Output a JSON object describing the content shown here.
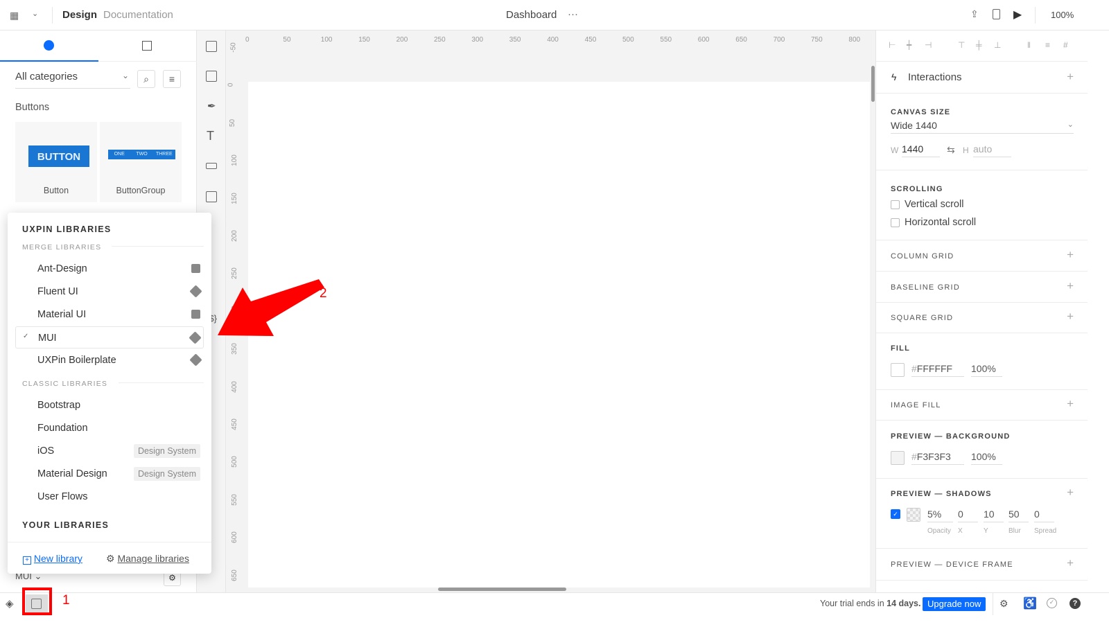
{
  "topbar": {
    "tabs": [
      "Design",
      "Documentation"
    ],
    "title": "Dashboard",
    "more": "···",
    "zoom": "100%"
  },
  "left": {
    "category": "All categories",
    "section": "Buttons",
    "components": [
      {
        "label": "Button",
        "preview": "BUTTON"
      },
      {
        "label": "ButtonGroup",
        "preview": [
          "ONE",
          "TWO",
          "THREE"
        ]
      }
    ],
    "library": "MUI"
  },
  "popup": {
    "title": "UXPIN LIBRARIES",
    "merge_header": "MERGE LIBRARIES",
    "merge": [
      {
        "name": "Ant-Design",
        "icon": "storybook-icon"
      },
      {
        "name": "Fluent UI",
        "icon": "git-icon"
      },
      {
        "name": "Material UI",
        "icon": "storybook-s-icon"
      },
      {
        "name": "MUI",
        "icon": "git-icon",
        "selected": true
      },
      {
        "name": "UXPin Boilerplate",
        "icon": "git-icon"
      }
    ],
    "classic_header": "CLASSIC LIBRARIES",
    "classic": [
      {
        "name": "Bootstrap"
      },
      {
        "name": "Foundation"
      },
      {
        "name": "iOS",
        "badge": "Design System"
      },
      {
        "name": "Material Design",
        "badge": "Design System"
      },
      {
        "name": "User Flows"
      }
    ],
    "your_header": "YOUR LIBRARIES",
    "new_library": "New library",
    "manage_libraries": "Manage libraries"
  },
  "rulers": {
    "h": [
      "0",
      "50",
      "100",
      "150",
      "200",
      "250",
      "300",
      "350",
      "400",
      "450",
      "500",
      "550",
      "600",
      "650",
      "700",
      "750",
      "800"
    ],
    "v": [
      "-50",
      "0",
      "50",
      "100",
      "150",
      "200",
      "250",
      "300",
      "350",
      "400",
      "450",
      "500",
      "550",
      "600",
      "650"
    ]
  },
  "tools": {
    "variables": "{$}"
  },
  "right": {
    "interactions": "Interactions",
    "canvas_size": {
      "label": "CANVAS SIZE",
      "preset": "Wide 1440",
      "w_label": "W",
      "w": "1440",
      "h_label": "H",
      "h_placeholder": "auto"
    },
    "scrolling": {
      "label": "SCROLLING",
      "vertical": "Vertical scroll",
      "horizontal": "Horizontal scroll"
    },
    "column_grid": "COLUMN GRID",
    "baseline_grid": "BASELINE GRID",
    "square_grid": "SQUARE GRID",
    "fill": {
      "label": "FILL",
      "hash": "#",
      "color": "FFFFFF",
      "opacity": "100%"
    },
    "image_fill": "IMAGE FILL",
    "preview_bg": {
      "label": "PREVIEW — BACKGROUND",
      "hash": "#",
      "color": "F3F3F3",
      "opacity": "100%"
    },
    "shadows": {
      "label": "PREVIEW — SHADOWS",
      "enabled": true,
      "opacity": "5%",
      "x": "0",
      "y": "10",
      "blur": "50",
      "spread": "0",
      "labels": [
        "Opacity",
        "X",
        "Y",
        "Blur",
        "Spread"
      ]
    },
    "device_frame": "PREVIEW — DEVICE FRAME"
  },
  "bottom": {
    "trial_prefix": "Your trial ends in ",
    "trial_days": "14 days.",
    "upgrade": "Upgrade now"
  },
  "annotations": {
    "one": "1",
    "two": "2",
    "color": "#ff0000"
  },
  "colors": {
    "accent": "#0a6cff",
    "button_blue": "#1976d2"
  }
}
